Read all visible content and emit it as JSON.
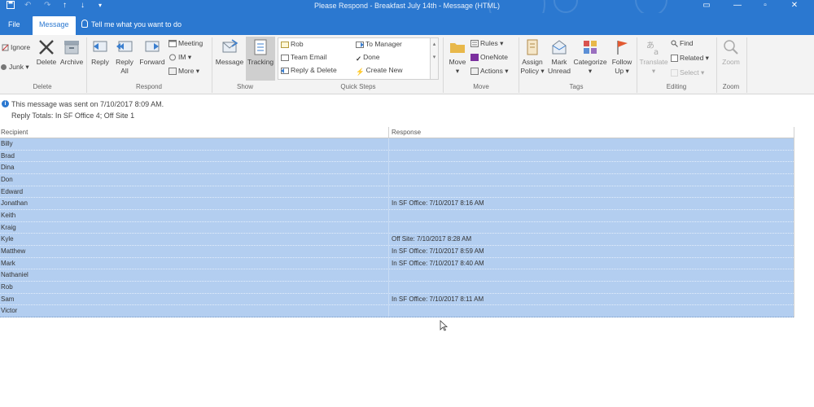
{
  "window": {
    "title": "Please Respond - Breakfast July 14th - Message (HTML)"
  },
  "tabs": {
    "file": "File",
    "message": "Message",
    "tell_me": "Tell me what you want to do"
  },
  "ribbon": {
    "delete": {
      "ignore": "Ignore",
      "junk": "Junk",
      "delete": "Delete",
      "archive": "Archive",
      "label": "Delete"
    },
    "respond": {
      "reply": "Reply",
      "reply_all_1": "Reply",
      "reply_all_2": "All",
      "forward": "Forward",
      "meeting": "Meeting",
      "im": "IM",
      "more": "More",
      "label": "Respond"
    },
    "show": {
      "message": "Message",
      "tracking": "Tracking",
      "label": "Show"
    },
    "quick_steps": {
      "items": [
        "Rob",
        "Team Email",
        "Reply & Delete",
        "To Manager",
        "Done",
        "Create New"
      ],
      "label": "Quick Steps"
    },
    "move": {
      "move": "Move",
      "rules": "Rules",
      "onenote": "OneNote",
      "actions": "Actions",
      "label": "Move"
    },
    "tags": {
      "assign_1": "Assign",
      "assign_2": "Policy",
      "mark_1": "Mark",
      "mark_2": "Unread",
      "categorize": "Categorize",
      "follow_1": "Follow",
      "follow_2": "Up",
      "label": "Tags"
    },
    "editing": {
      "translate": "Translate",
      "find": "Find",
      "related": "Related",
      "select": "Select",
      "label": "Editing"
    },
    "zoom": {
      "zoom": "Zoom",
      "label": "Zoom"
    }
  },
  "info": {
    "sent": "This message was sent on 7/10/2017 8:09 AM.",
    "totals": "Reply Totals: In SF Office 4; Off Site 1"
  },
  "table": {
    "headers": {
      "recipient": "Recipient",
      "response": "Response"
    },
    "rows": [
      {
        "recipient": "Billy",
        "response": ""
      },
      {
        "recipient": "Brad",
        "response": ""
      },
      {
        "recipient": "Dina",
        "response": ""
      },
      {
        "recipient": "Don",
        "response": ""
      },
      {
        "recipient": "Edward",
        "response": ""
      },
      {
        "recipient": "Jonathan",
        "response": "In SF Office: 7/10/2017 8:16 AM"
      },
      {
        "recipient": "Keith",
        "response": ""
      },
      {
        "recipient": "Kraig",
        "response": ""
      },
      {
        "recipient": "Kyle",
        "response": "Off Site: 7/10/2017 8:28 AM"
      },
      {
        "recipient": "Matthew",
        "response": "In SF Office: 7/10/2017 8:59 AM"
      },
      {
        "recipient": "Mark",
        "response": "In SF Office: 7/10/2017 8:40 AM"
      },
      {
        "recipient": "Nathaniel",
        "response": ""
      },
      {
        "recipient": "Rob",
        "response": ""
      },
      {
        "recipient": "Sam",
        "response": "In SF Office: 7/10/2017 8:11 AM"
      },
      {
        "recipient": "Victor",
        "response": ""
      }
    ]
  },
  "colors": {
    "accent": "#2b78d0",
    "row_selected": "#b3cef0",
    "ribbon_bg": "#f3f3f3"
  }
}
